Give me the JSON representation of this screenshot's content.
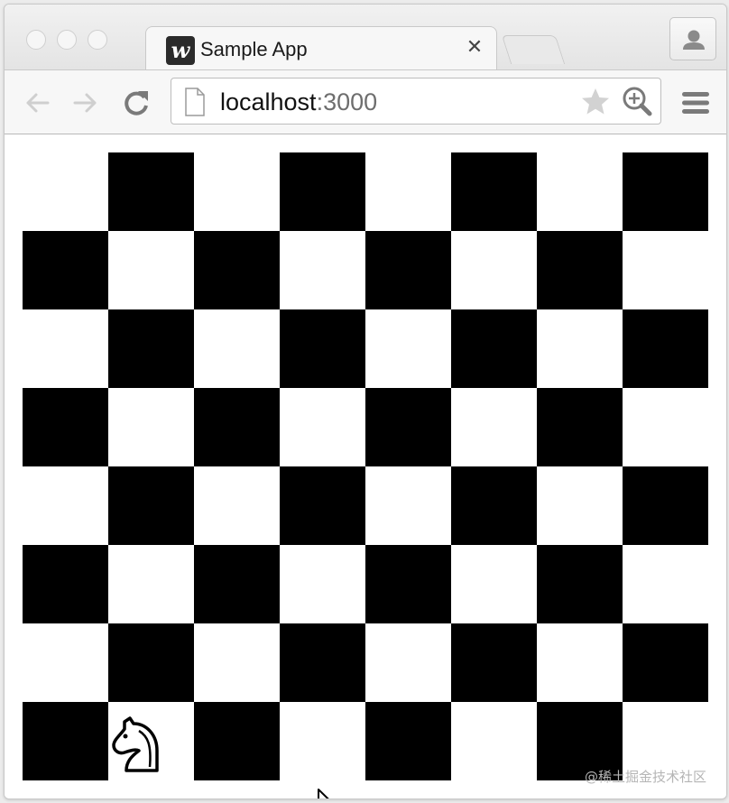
{
  "tab": {
    "favicon_letter": "w",
    "title": "Sample App",
    "close_symbol": "✕"
  },
  "toolbar": {
    "back_icon": "arrow-left-icon",
    "forward_icon": "arrow-right-icon",
    "reload_icon": "reload-icon",
    "menu_icon": "hamburger-menu-icon"
  },
  "address_bar": {
    "host": "localhost",
    "port": ":3000",
    "bookmark_icon": "star-icon",
    "zoom_icon": "zoom-in-icon"
  },
  "board": {
    "rows": 8,
    "columns": 8,
    "light_color": "#ffffff",
    "dark_color": "#000000",
    "pieces": [
      {
        "name": "knight",
        "glyph": "♘",
        "row": 7,
        "col": 1
      }
    ]
  },
  "watermark": "@稀土掘金技术社区"
}
